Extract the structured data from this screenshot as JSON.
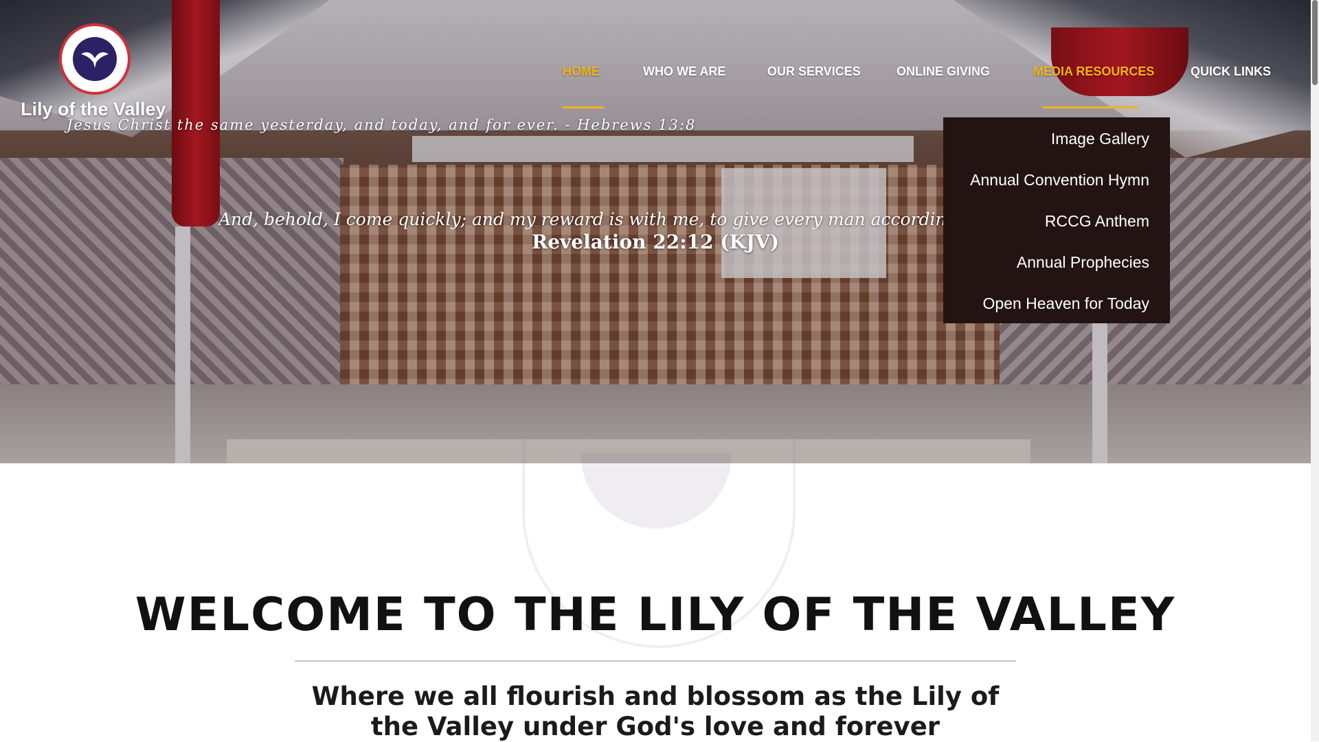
{
  "site": {
    "title": "Lily of the Valley",
    "tagline": "Jesus Christ the same yesterday, and today, and for ever. - Hebrews 13:8"
  },
  "nav": {
    "items": [
      {
        "label": "HOME",
        "active": true
      },
      {
        "label": "WHO WE ARE",
        "active": false
      },
      {
        "label": "OUR SERVICES",
        "active": false
      },
      {
        "label": "ONLINE GIVING",
        "active": false
      },
      {
        "label": "MEDIA RESOURCES",
        "active": true
      },
      {
        "label": "QUICK LINKS",
        "active": false
      }
    ],
    "accent_color": "#f5b21b"
  },
  "dropdown": {
    "parent": "MEDIA RESOURCES",
    "items": [
      {
        "label": "Image Gallery"
      },
      {
        "label": "Annual Convention Hymn"
      },
      {
        "label": "RCCG Anthem"
      },
      {
        "label": "Annual Prophecies"
      },
      {
        "label": "Open Heaven for Today"
      }
    ],
    "background": "#231313"
  },
  "hero": {
    "verse": "And, behold, I come quickly; and my reward is with me, to give every man according as",
    "verse_reference": "Revelation 22:12 (KJV)"
  },
  "welcome": {
    "title": "WELCOME TO THE LILY OF THE VALLEY",
    "subtitle_line1": "Where we all flourish and blossom as the Lily of",
    "subtitle_line2": "the Valley under God's love and forever"
  }
}
